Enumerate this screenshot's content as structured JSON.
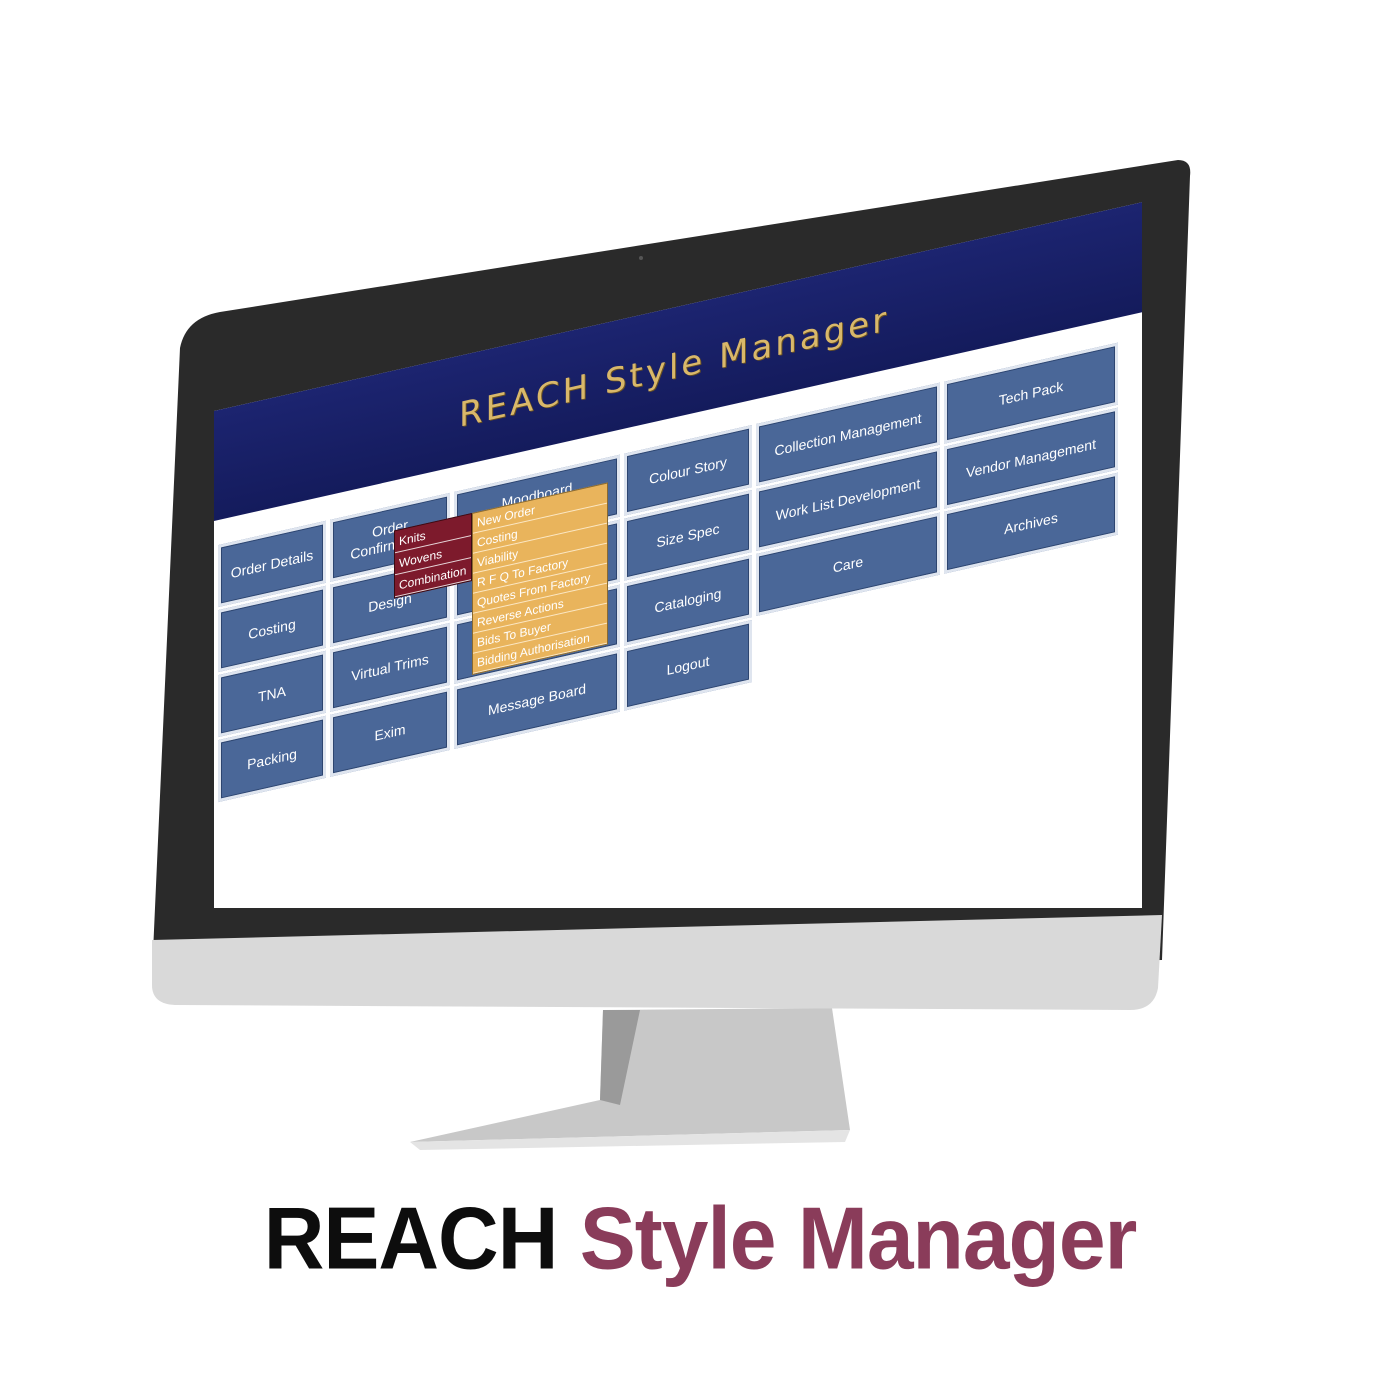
{
  "app": {
    "title": "REACH Style Manager"
  },
  "tiles": {
    "order_details": "Order Details",
    "order_confirmation": "Order Confirmation",
    "moodboard_development": "Moodboard Development",
    "colour_story": "Colour Story",
    "collection_management": "Collection Management",
    "tech_pack": "Tech Pack",
    "costing": "Costing",
    "design": "Design",
    "size_spec": "Size Spec",
    "work_list_development": "Work List Development",
    "vendor_management": "Vendor Management",
    "tna": "TNA",
    "virtual_trims": "Virtual Trims",
    "cataloging": "Cataloging",
    "care": "Care",
    "archives": "Archives",
    "packing": "Packing",
    "exim": "Exim",
    "message_board": "Message Board",
    "logout": "Logout"
  },
  "order_confirmation_menu": [
    "Knits",
    "Wovens",
    "Combination"
  ],
  "moodboard_menu": [
    "New Order",
    "Costing",
    "Viability",
    "R F Q To Factory",
    "Quotes From Factory",
    "Reverse Actions",
    "Bids To Buyer",
    "Bidding Authorisation"
  ],
  "caption": {
    "word1": "REACH",
    "word2": "Style Manager"
  },
  "colors": {
    "header": "#1c2470",
    "title_gold": "#d9b86a",
    "tile": "#4a6798",
    "menu_maroon": "#7d1a2c",
    "menu_amber": "#e9b45c",
    "caption_dark": "#0d0d0d",
    "caption_accent": "#8a3c5a"
  }
}
